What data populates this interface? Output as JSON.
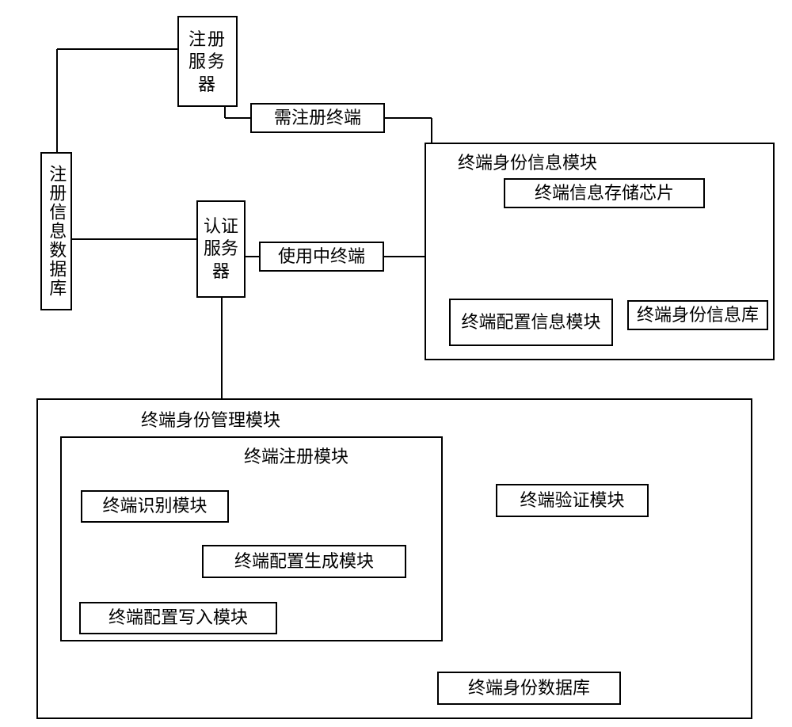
{
  "nodes": {
    "regDb": "注册信息数据库",
    "regServer": "注册服务器",
    "authServer": "认证服务器",
    "needRegTerm": "需注册终端",
    "inUseTerm": "使用中终端",
    "idInfoModule": "终端身份信息模块",
    "infoChip": "终端信息存储芯片",
    "cfgInfoModule": "终端配置信息模块",
    "idInfoDb": "终端身份信息库",
    "idMgmtModule": "终端身份管理模块",
    "regModule": "终端注册模块",
    "recogModule": "终端识别模块",
    "cfgGenModule": "终端配置生成模块",
    "cfgWriteModule": "终端配置写入模块",
    "verifyModule": "终端验证模块",
    "idDb": "终端身份数据库"
  }
}
